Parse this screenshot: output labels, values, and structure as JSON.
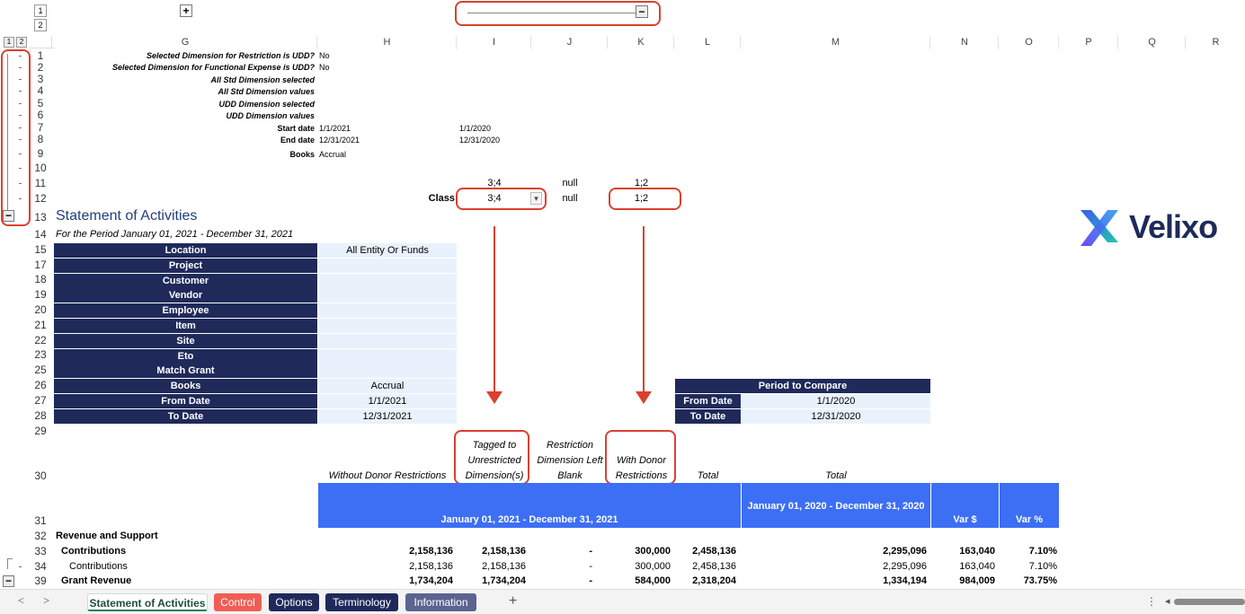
{
  "outline_top": {
    "level1": "1",
    "level2": "2",
    "expand": "+",
    "collapse": "−"
  },
  "outline_left": {
    "level1": "1",
    "level2": "2",
    "collapse": "−"
  },
  "columns": [
    "G",
    "H",
    "I",
    "J",
    "K",
    "L",
    "M",
    "N",
    "O",
    "P",
    "Q",
    "R"
  ],
  "rows": [
    "1",
    "2",
    "3",
    "4",
    "5",
    "6",
    "7",
    "8",
    "9",
    "10",
    "11",
    "12",
    "13",
    "14",
    "15",
    "17",
    "18",
    "19",
    "20",
    "21",
    "22",
    "23",
    "25",
    "26",
    "27",
    "28",
    "29",
    "30",
    "31",
    "32",
    "33",
    "34",
    "39"
  ],
  "params": {
    "r1_label": "Selected Dimension for Restriction is UDD?",
    "r1_val": "No",
    "r2_label": "Selected Dimension for Functional Expense is UDD?",
    "r2_val": "No",
    "r3_label": "All Std Dimension selected",
    "r4_label": "All Std Dimension values",
    "r5_label": "UDD Dimension selected",
    "r6_label": "UDD Dimension values",
    "r7_label": "Start date",
    "r7_val": "1/1/2021",
    "r7_val2": "1/1/2020",
    "r8_label": "End date",
    "r8_val": "12/31/2021",
    "r8_val2": "12/31/2020",
    "r9_label": "Books",
    "r9_val": "Accrual",
    "r11_i": "3;4",
    "r11_j": "null",
    "r11_k": "1;2",
    "r12_label": "Class",
    "r12_i": "3;4",
    "r12_j": "null",
    "r12_k": "1;2",
    "dropdown_icon": "▾"
  },
  "title": "Statement of Activities",
  "subtitle": "For the Period January 01, 2021 - December 31, 2021",
  "logo_text": "Velixo",
  "filters": [
    {
      "label": "Location",
      "value": "All Entity Or Funds"
    },
    {
      "label": "Project",
      "value": ""
    },
    {
      "label": "Customer",
      "value": ""
    },
    {
      "label": "Vendor",
      "value": ""
    },
    {
      "label": "Employee",
      "value": ""
    },
    {
      "label": "Item",
      "value": ""
    },
    {
      "label": "Site",
      "value": ""
    },
    {
      "label": "Eto",
      "value": ""
    },
    {
      "label": "Match Grant",
      "value": ""
    },
    {
      "label": "Books",
      "value": "Accrual"
    },
    {
      "label": "From Date",
      "value": "1/1/2021"
    },
    {
      "label": "To Date",
      "value": "12/31/2021"
    }
  ],
  "compare": {
    "title": "Period to Compare",
    "from_label": "From Date",
    "from_val": "1/1/2020",
    "to_label": "To Date",
    "to_val": "12/31/2020"
  },
  "col_headers": {
    "h": "Without Donor Restrictions",
    "i": "Tagged to Unrestricted Dimension(s)",
    "j": "Restriction Dimension Left Blank",
    "k": "With Donor Restrictions",
    "l": "Total",
    "m": "Total"
  },
  "period_headers": {
    "current": "January 01, 2021 - December 31, 2021",
    "prior": "January 01, 2020 - December 31, 2020",
    "var_amt": "Var $",
    "var_pct": "Var %"
  },
  "table": [
    {
      "label": "Revenue and Support",
      "bold": true,
      "indent": 0,
      "h": "",
      "i": "",
      "j": "",
      "k": "",
      "l": "",
      "m": "",
      "n": "",
      "o": ""
    },
    {
      "label": "Contributions",
      "bold": true,
      "indent": 1,
      "h": "2,158,136",
      "i": "2,158,136",
      "j": "-",
      "k": "300,000",
      "l": "2,458,136",
      "m": "2,295,096",
      "n": "163,040",
      "o": "7.10%"
    },
    {
      "label": "Contributions",
      "bold": false,
      "indent": 2,
      "h": "2,158,136",
      "i": "2,158,136",
      "j": "-",
      "k": "300,000",
      "l": "2,458,136",
      "m": "2,295,096",
      "n": "163,040",
      "o": "7.10%"
    },
    {
      "label": "Grant Revenue",
      "bold": true,
      "indent": 1,
      "h": "1,734,204",
      "i": "1,734,204",
      "j": "-",
      "k": "584,000",
      "l": "2,318,204",
      "m": "1,334,194",
      "n": "984,009",
      "o": "73.75%"
    }
  ],
  "sheet_tabs": [
    {
      "label": "Statement of Activities",
      "active": true
    },
    {
      "label": "Control"
    },
    {
      "label": "Options"
    },
    {
      "label": "Terminology"
    },
    {
      "label": "Information"
    }
  ],
  "add_sheet": "+",
  "nav_prev": "<",
  "nav_next": ">",
  "more_icon": "⋮",
  "scroll_left": "◂",
  "colors": {
    "navy": "#1f2a5a",
    "blue_header": "#3d6ff5",
    "light": "#e9f2fc",
    "red": "#d9412e",
    "control_tab": "#ef5e55",
    "info_tab": "#5b6490"
  }
}
